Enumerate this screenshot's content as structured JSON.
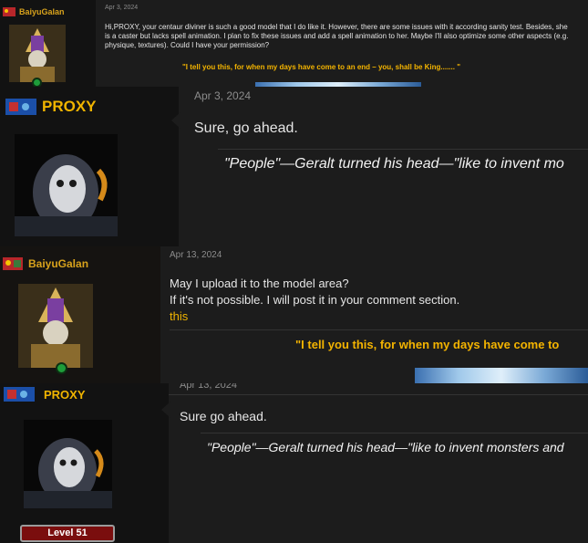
{
  "posts": [
    {
      "username": "BaiyuGalan",
      "date": "Apr 3, 2024",
      "text": "Hi,PROXY, your centaur diviner is such a good model that I do like it. However, there are some issues with it according sanity test. Besides, she is a caster but lacks spell animation. I plan to fix these issues and add a spell animation to her. Maybe I'll also optimize some other aspects (e.g. physique, textures). Could I have your permission?",
      "quote": "\"I tell you this, for when my days have come to an end – you, shall be King....... \"",
      "online": true
    },
    {
      "username": "PROXY",
      "date": "Apr 3, 2024",
      "text": "Sure, go ahead.",
      "signature": "\"People\"—Geralt turned his head—\"like to invent mo"
    },
    {
      "username": "BaiyuGalan",
      "date": "Apr 13, 2024",
      "lines": [
        "May I upload it to the model area?",
        "If it's not possible. I will post it in your comment section."
      ],
      "link": "this",
      "quote": "\"I tell you this, for when my days have come to",
      "online": true
    },
    {
      "username": "PROXY",
      "date": "Apr 13, 2024",
      "text": "Sure go ahead.",
      "signature": "\"People\"—Geralt turned his head—\"like to invent monsters and",
      "level": "Level 51"
    }
  ],
  "colors": {
    "accent": "#f0b400",
    "online": "#1e9d3a",
    "level_bg": "#7a0e0e"
  }
}
